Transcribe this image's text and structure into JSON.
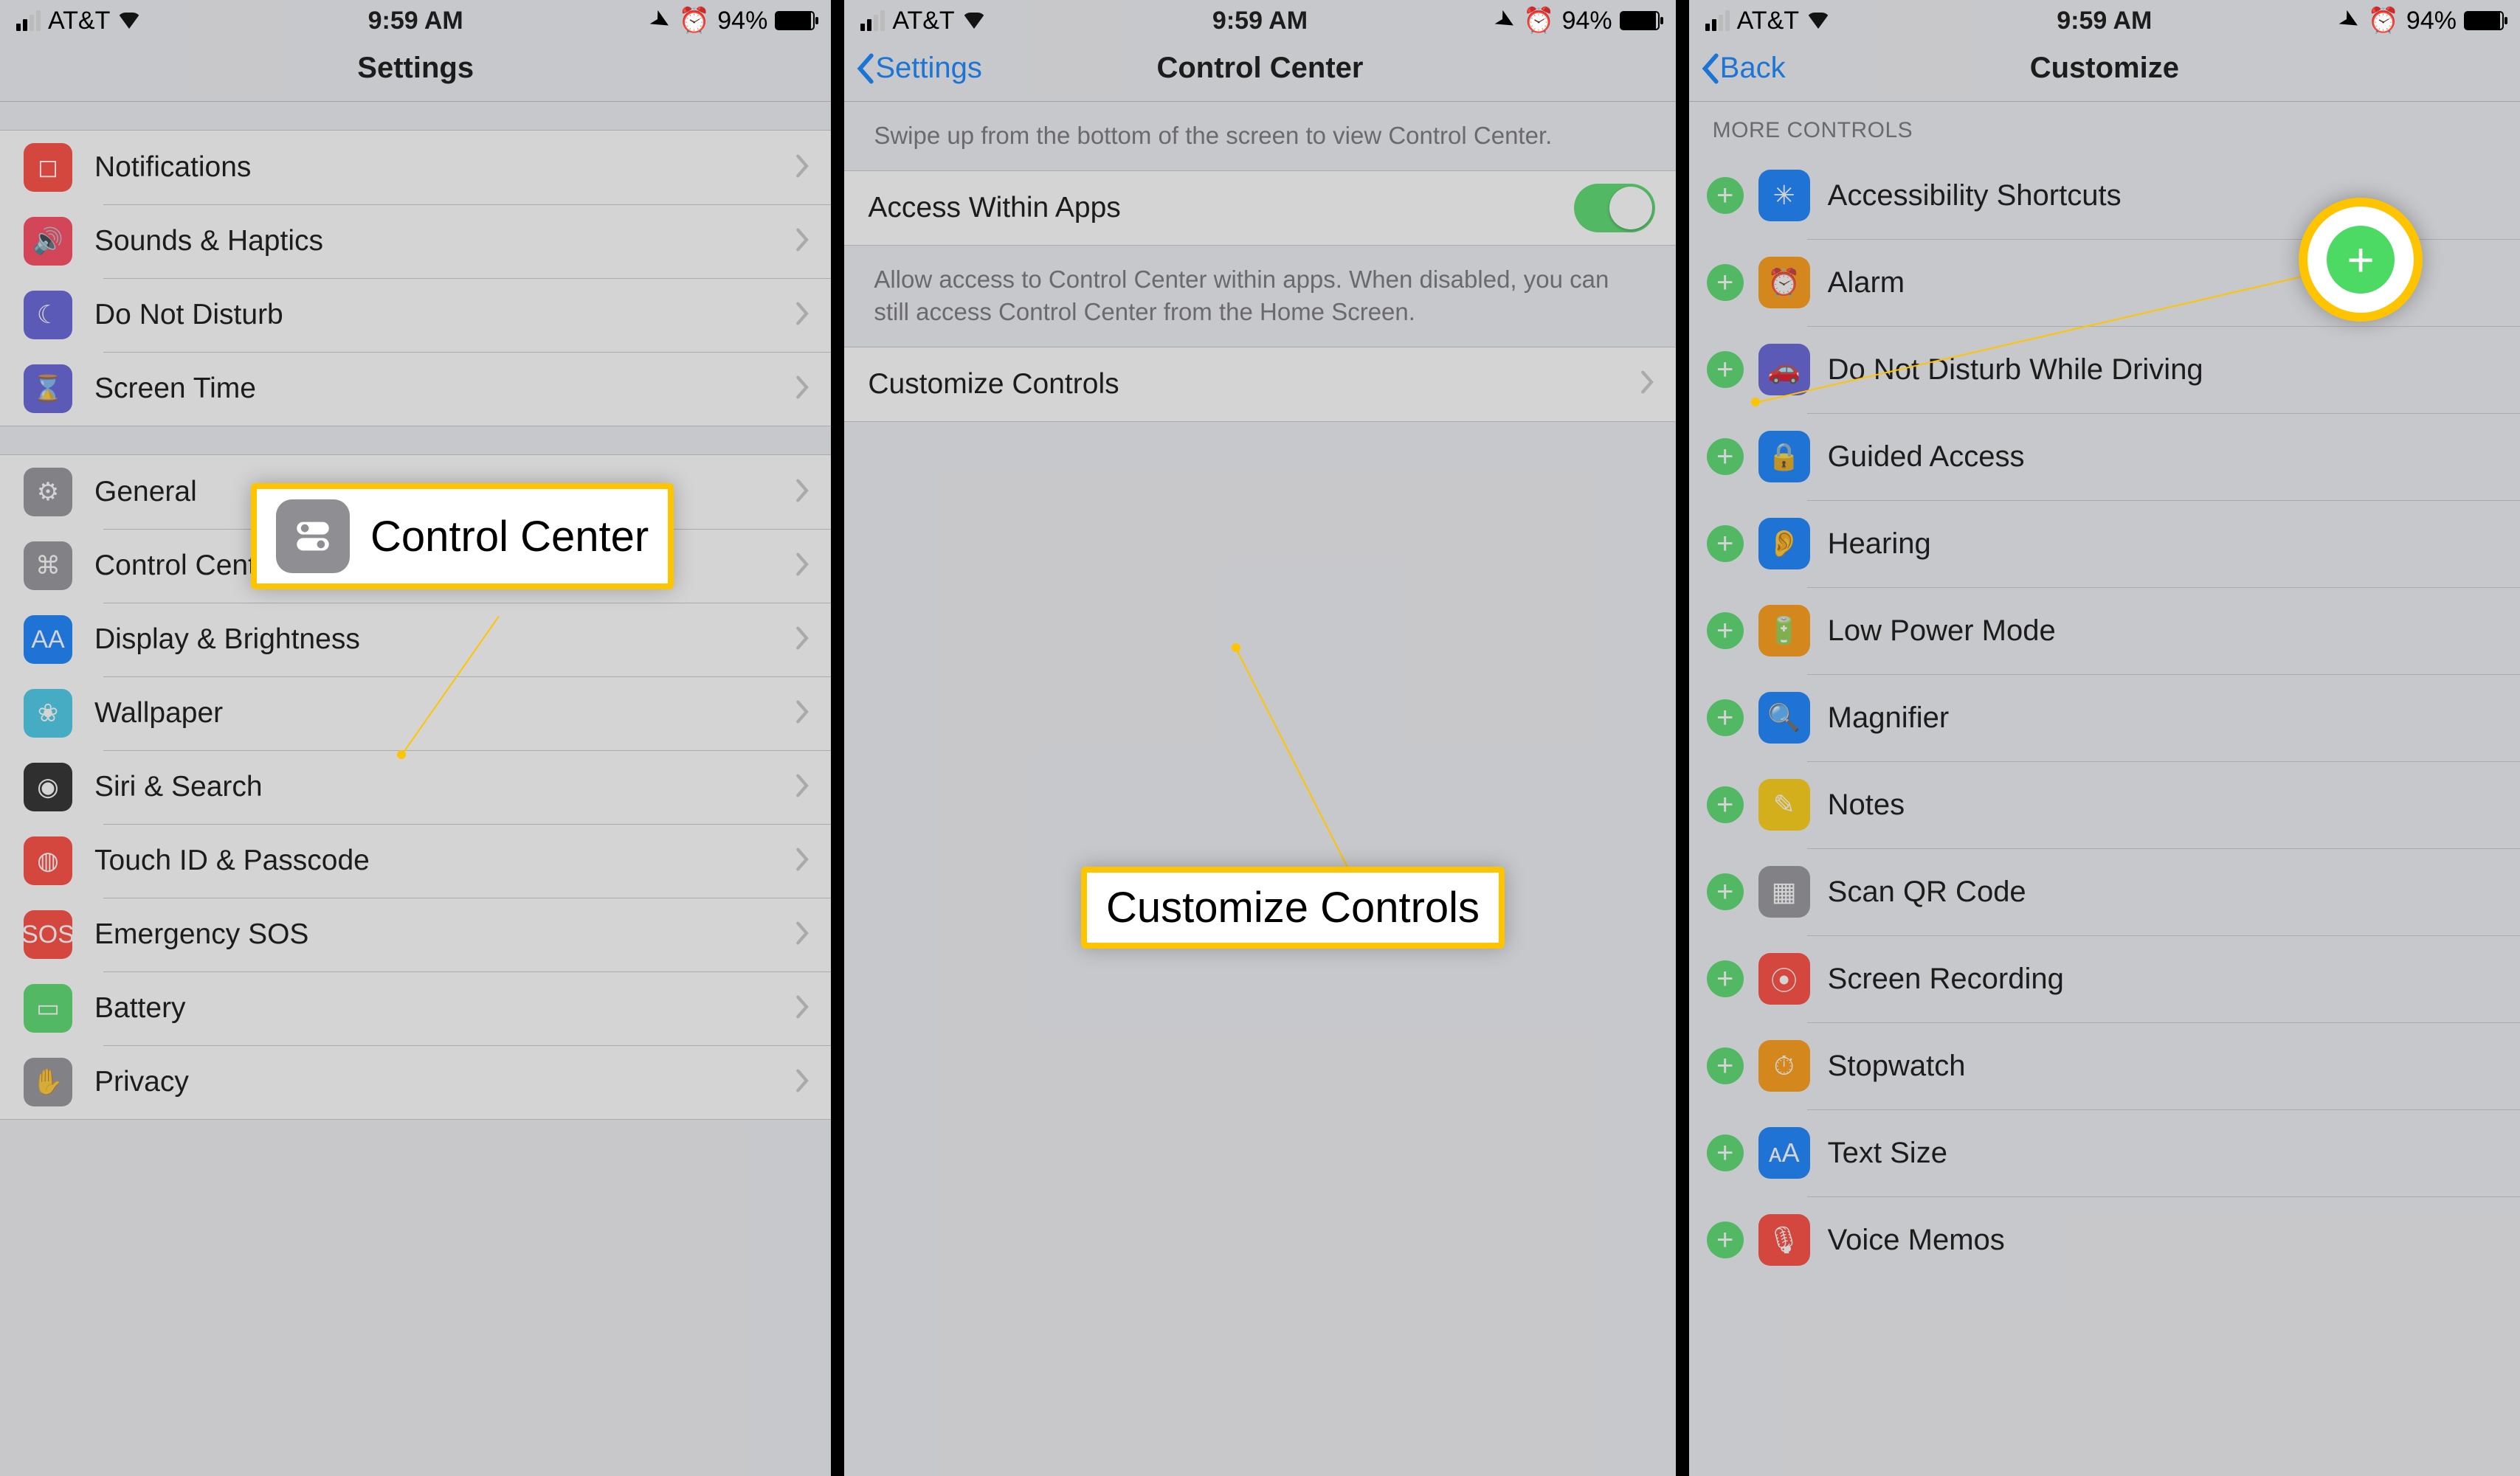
{
  "status": {
    "carrier": "AT&T",
    "time": "9:59 AM",
    "battery": "94%"
  },
  "screen1": {
    "title": "Settings",
    "group1": [
      {
        "label": "Notifications",
        "icon": "square-rounded",
        "bg": "#fe3c30"
      },
      {
        "label": "Sounds & Haptics",
        "icon": "speaker",
        "bg": "#fe3a55"
      },
      {
        "label": "Do Not Disturb",
        "icon": "moon",
        "bg": "#5856d6"
      },
      {
        "label": "Screen Time",
        "icon": "hourglass",
        "bg": "#5856d6"
      }
    ],
    "group2": [
      {
        "label": "General",
        "icon": "gear",
        "bg": "#8e8e93"
      },
      {
        "label": "Control Center",
        "icon": "switches",
        "bg": "#8e8e93"
      },
      {
        "label": "Display & Brightness",
        "icon": "AA",
        "bg": "#0579ff"
      },
      {
        "label": "Wallpaper",
        "icon": "flower",
        "bg": "#39c8e8"
      },
      {
        "label": "Siri & Search",
        "icon": "siri",
        "bg": "#1b1b1d"
      },
      {
        "label": "Touch ID & Passcode",
        "icon": "fingerprint",
        "bg": "#fe3c30"
      },
      {
        "label": "Emergency SOS",
        "icon": "SOS",
        "bg": "#fe3c30"
      },
      {
        "label": "Battery",
        "icon": "battery",
        "bg": "#4cd964"
      },
      {
        "label": "Privacy",
        "icon": "hand",
        "bg": "#8e8e93"
      }
    ],
    "callout": "Control Center"
  },
  "screen2": {
    "back": "Settings",
    "title": "Control Center",
    "help1": "Swipe up from the bottom of the screen to view Control Center.",
    "toggleLabel": "Access Within Apps",
    "help2": "Allow access to Control Center within apps. When disabled, you can still access Control Center from the Home Screen.",
    "customize": "Customize Controls",
    "callout": "Customize Controls"
  },
  "screen3": {
    "back": "Back",
    "title": "Customize",
    "section": "MORE CONTROLS",
    "items": [
      {
        "label": "Accessibility Shortcuts",
        "bg": "#0579ff",
        "glyph": "✳"
      },
      {
        "label": "Alarm",
        "bg": "#ff9500",
        "glyph": "⏰"
      },
      {
        "label": "Do Not Disturb While Driving",
        "bg": "#5856d6",
        "glyph": "🚗"
      },
      {
        "label": "Guided Access",
        "bg": "#0579ff",
        "glyph": "🔒"
      },
      {
        "label": "Hearing",
        "bg": "#0579ff",
        "glyph": "👂"
      },
      {
        "label": "Low Power Mode",
        "bg": "#ff9500",
        "glyph": "🔋"
      },
      {
        "label": "Magnifier",
        "bg": "#0579ff",
        "glyph": "🔍"
      },
      {
        "label": "Notes",
        "bg": "#ffcc00",
        "glyph": "✎"
      },
      {
        "label": "Scan QR Code",
        "bg": "#8e8e93",
        "glyph": "▦"
      },
      {
        "label": "Screen Recording",
        "bg": "#fe3c30",
        "glyph": "⦿"
      },
      {
        "label": "Stopwatch",
        "bg": "#ff9500",
        "glyph": "⏱"
      },
      {
        "label": "Text Size",
        "bg": "#0579ff",
        "glyph": "ᴀA"
      },
      {
        "label": "Voice Memos",
        "bg": "#fe3c30",
        "glyph": "🎙"
      }
    ]
  }
}
